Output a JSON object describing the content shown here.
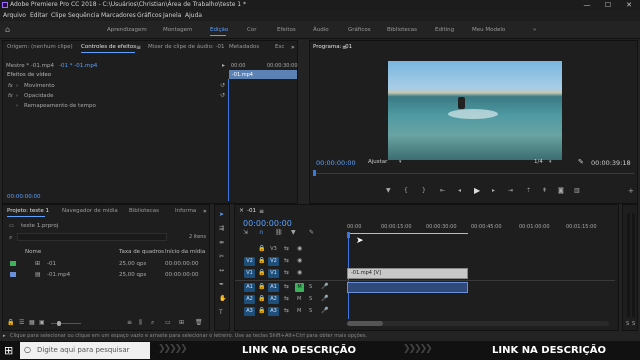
{
  "titlebar": {
    "title": "Adobe Premiere Pro CC 2018 - C:\\Usuários\\Christian\\Área de Trabalho\\teste 1 *",
    "minimize": "—",
    "maximize": "☐",
    "close": "✕"
  },
  "menu": [
    "Arquivo",
    "Editar",
    "Clipe",
    "Sequência",
    "Marcadores",
    "Gráficos",
    "Janela",
    "Ajuda"
  ],
  "workspaces": {
    "home": "⌂",
    "items": [
      "Aprendizagem",
      "Montagem",
      "Edição",
      "Cor",
      "Efeitos",
      "Áudio",
      "Gráficos",
      "Bibliotecas",
      "Editing",
      "Meu Modelo"
    ],
    "active": "Edição",
    "more": "»"
  },
  "source_panel": {
    "tabs": [
      "Origem: (nenhum clipe)",
      "Controles de efeitos",
      "Mixer de clipe de áudio: -01",
      "Metadados",
      "Esc"
    ],
    "active_tab": "Controles de efeitos",
    "menu_icon": "≡",
    "more": "»",
    "master": "Mestre * -01.mp4",
    "clip": "-01 * -01.mp4",
    "ruler_start": "00:00",
    "ruler_end": "00:00:30:00",
    "clip_label": "-01.mp4",
    "section": "Efeitos de vídeo",
    "effects": [
      "Movimento",
      "Opacidade",
      "Remapeamento de tempo"
    ],
    "timecode": "00:00:00:00"
  },
  "program": {
    "title": "Programa: -01",
    "menu_icon": "≡",
    "timecode": "00:00:00:00",
    "fit": "Ajustar",
    "fraction": "1/4",
    "duration": "00:00:39:18",
    "wrench": "🔧"
  },
  "project": {
    "tabs": [
      "Projeto: teste 1",
      "Navegador de mídia",
      "Bibliotecas",
      "Informa"
    ],
    "active_tab": "Projeto: teste 1",
    "more": "»",
    "file": "teste 1.prproj",
    "count": "2 itens",
    "columns": [
      "Nome",
      "Taxa de quadros",
      "Início da mídia"
    ],
    "items": [
      {
        "name": "-01",
        "fps": "25,00 qps",
        "start": "00:00:00:00",
        "color": "#3cb35a"
      },
      {
        "name": "-01.mp4",
        "fps": "25,00 qps",
        "start": "00:00:00:00",
        "color": "#6b8fd8"
      }
    ]
  },
  "timeline": {
    "tab": "-01",
    "menu_icon": "≡",
    "close": "×",
    "timecode": "00:00:00:00",
    "ruler": [
      "00:00",
      "00:00:15:00",
      "00:00:30:00",
      "00:00:45:00",
      "00:01:00:00",
      "00:01:15:00"
    ],
    "video_tracks": [
      "V3",
      "V2",
      "V1"
    ],
    "audio_tracks": [
      "A1",
      "A2",
      "A3"
    ],
    "source_v": "V1",
    "source_a": "A1",
    "video_clip": "-01.mp4 [V]",
    "m": "M",
    "s": "S"
  },
  "meters": {
    "left": "S",
    "right": "S"
  },
  "status": "Clique para selecionar ou clique em um espaço vazio e arraste para selecionar o letreiro. Use as teclas Shift+Alt+Ctrl para obter mais opções.",
  "taskbar": {
    "search": "Digite aqui para pesquisar",
    "banner1": "LINK NA DESCRIÇÃO",
    "banner2": "LINK NA DESCRIÇÃO"
  },
  "colors": {
    "accent": "#5aa0ff",
    "playhead": "#3a78e0",
    "track_target": "#1d4f7a",
    "mute_active": "#3cb35a",
    "work_area": "#d4c44a"
  }
}
